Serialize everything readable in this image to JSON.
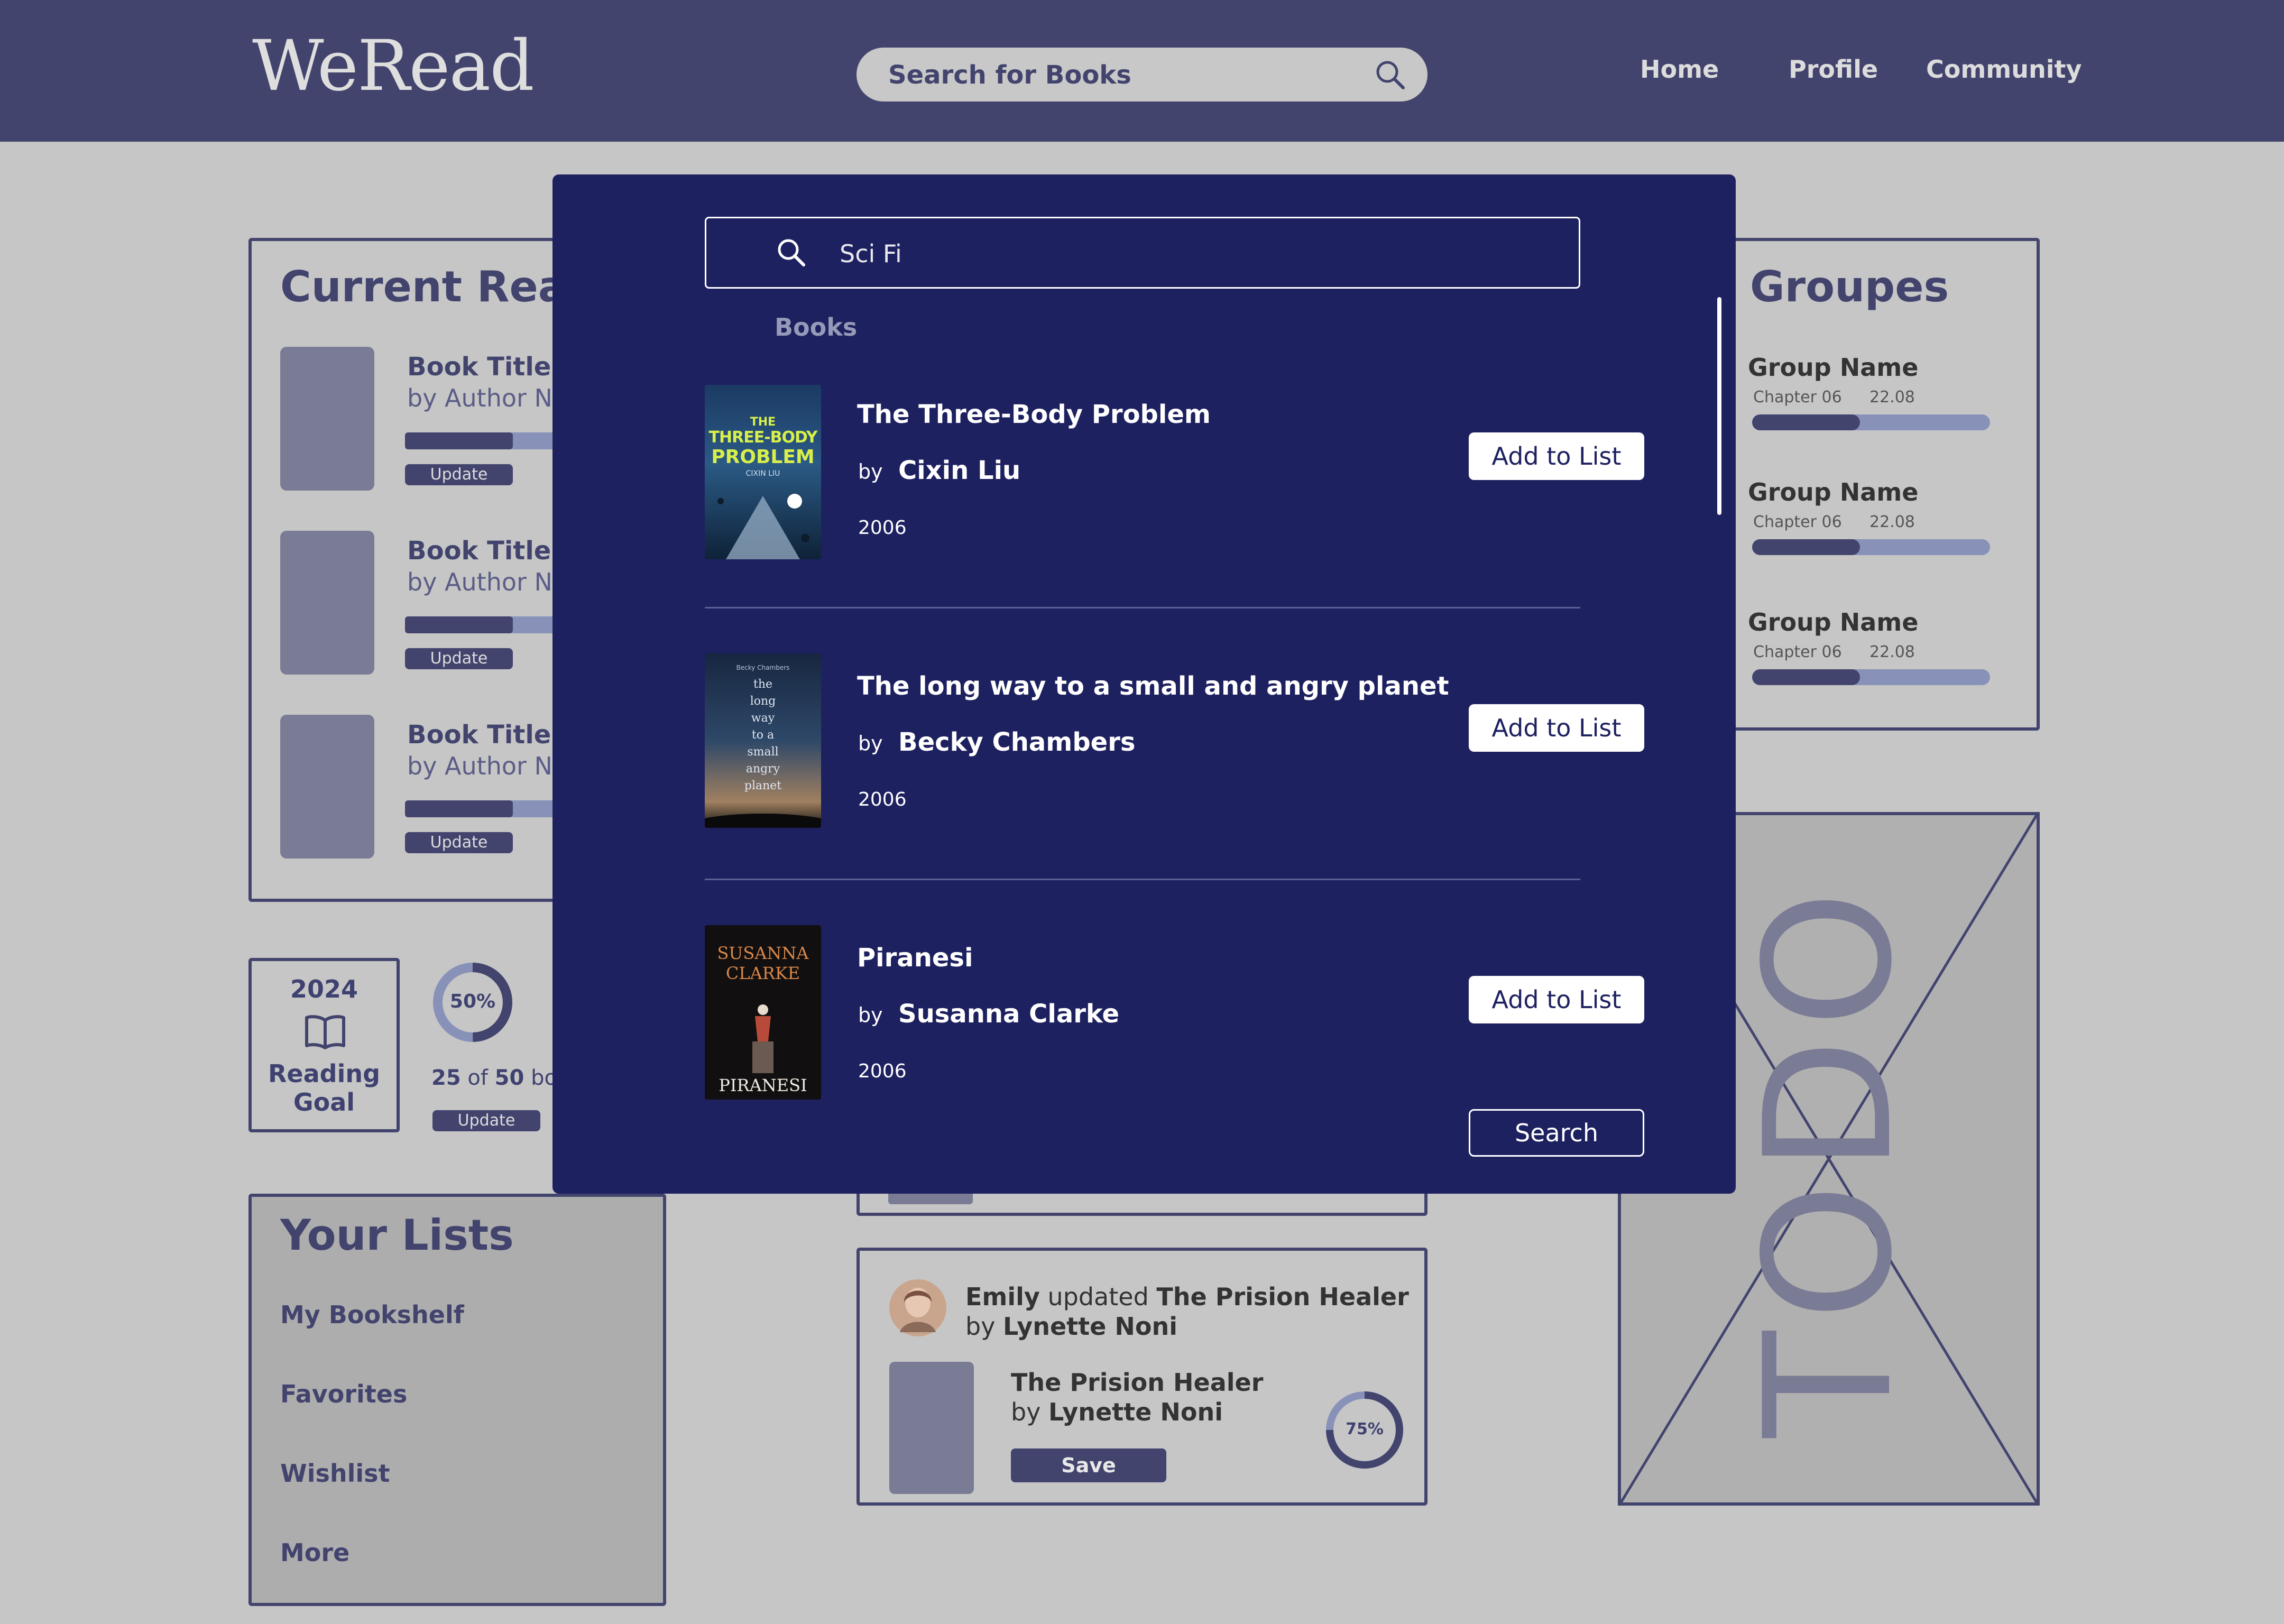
{
  "header": {
    "logo": "WeRead",
    "search_placeholder": "Search for Books",
    "nav": [
      "Home",
      "Profile",
      "Community"
    ]
  },
  "current_reading": {
    "title": "Current Read",
    "books": [
      {
        "title": "Book Title",
        "author": "by Author N",
        "button": "Update"
      },
      {
        "title": "Book Title",
        "author": "by Author N",
        "button": "Update"
      },
      {
        "title": "Book Title",
        "author": "by Author N",
        "button": "Update"
      }
    ]
  },
  "groups": {
    "title": "Groupes",
    "items": [
      {
        "name": "Group Name",
        "chapter": "Chapter 06",
        "date": "22.08"
      },
      {
        "name": "Group Name",
        "chapter": "Chapter 06",
        "date": "22.08"
      },
      {
        "name": "Group Name",
        "chapter": "Chapter 06",
        "date": "22.08"
      }
    ]
  },
  "reading_goal": {
    "year": "2024",
    "label_line1": "Reading",
    "label_line2": "Goal",
    "percent": "50%",
    "done": "25",
    "of": "of",
    "total": "50",
    "suffix": "bo",
    "button": "Update"
  },
  "lists": {
    "title": "Your Lists",
    "items": [
      "My Bookshelf",
      "Favorites",
      "Wishlist",
      "More"
    ]
  },
  "feed": {
    "user": "Emily",
    "verb": "updated",
    "book": "The Prision Healer",
    "by": "by",
    "author": "Lynette Noni",
    "card_title": "The Prision Healer",
    "card_by": "by",
    "card_author": "Lynette Noni",
    "save": "Save",
    "progress": "75%"
  },
  "todo": {
    "label": "TODO"
  },
  "modal": {
    "search_value": "Sci Fi",
    "section": "Books",
    "by": "by",
    "add_label": "Add to List",
    "search_button": "Search",
    "results": [
      {
        "title": "The Three-Body Problem",
        "author": "Cixin Liu",
        "year": "2006",
        "cover_lines": [
          "THE",
          "THREE-BODY",
          "PROBLEM",
          "CIXIN LIU"
        ]
      },
      {
        "title": "The long way to a small and angry planet",
        "author": "Becky Chambers",
        "year": "2006",
        "cover_lines": [
          "Becky Chambers",
          "the",
          "long",
          "way",
          "to a",
          "small",
          "angry",
          "planet"
        ]
      },
      {
        "title": "Piranesi",
        "author": "Susanna Clarke",
        "year": "2006",
        "cover_lines": [
          "SUSANNA",
          "CLARKE",
          "PIRANESI"
        ]
      }
    ]
  },
  "colors": {
    "header_bg": "#42446e",
    "page_bg": "#c6c6c6",
    "modal_bg": "#1e2160",
    "accent": "#8892b9"
  }
}
